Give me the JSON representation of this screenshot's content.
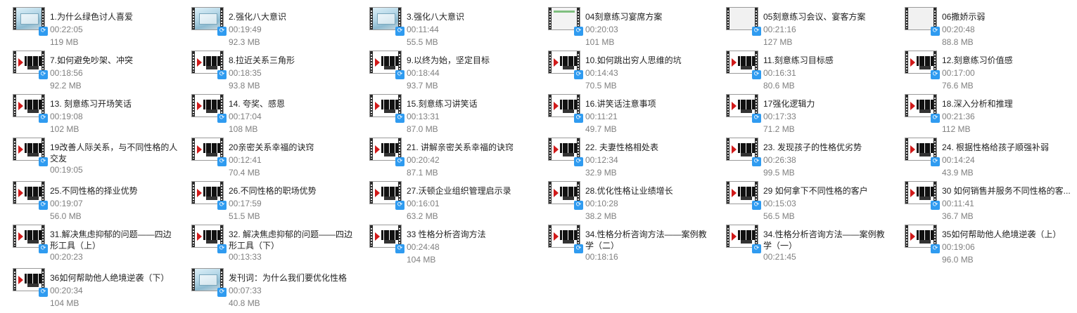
{
  "files": [
    {
      "name": "1.为什么绿色讨人喜爱",
      "duration": "00:22:05",
      "size": "119 MB",
      "thumb": "photo"
    },
    {
      "name": "2.强化八大意识",
      "duration": "00:19:49",
      "size": "92.3 MB",
      "thumb": "photo"
    },
    {
      "name": "3.强化八大意识",
      "duration": "00:11:44",
      "size": "55.5 MB",
      "thumb": "photo"
    },
    {
      "name": "04刻意练习宴席方案",
      "duration": "00:20:03",
      "size": "101 MB",
      "thumb": "doc"
    },
    {
      "name": "05刻意练习会议、宴客方案",
      "duration": "00:21:16",
      "size": "127 MB",
      "thumb": "blank"
    },
    {
      "name": "06撒娇示弱",
      "duration": "00:20:48",
      "size": "88.8 MB",
      "thumb": "blank"
    },
    {
      "name": "7.如何避免吵架、冲突",
      "duration": "00:18:56",
      "size": "92.2 MB",
      "thumb": "logo"
    },
    {
      "name": "8.拉近关系三角形",
      "duration": "00:18:35",
      "size": "93.8 MB",
      "thumb": "logo"
    },
    {
      "name": "9.以终为始，坚定目标",
      "duration": "00:18:44",
      "size": "93.7 MB",
      "thumb": "logo"
    },
    {
      "name": "10.如何跳出穷人思维的坑",
      "duration": "00:14:43",
      "size": "70.5 MB",
      "thumb": "logo"
    },
    {
      "name": "11.刻意练习目标感",
      "duration": "00:16:31",
      "size": "80.6 MB",
      "thumb": "logo"
    },
    {
      "name": "12.刻意练习价值感",
      "duration": "00:17:00",
      "size": "76.6 MB",
      "thumb": "logo"
    },
    {
      "name": "13. 刻意练习开场笑话",
      "duration": "00:19:08",
      "size": "102 MB",
      "thumb": "logo"
    },
    {
      "name": "14. 夸奖、感恩",
      "duration": "00:17:04",
      "size": "108 MB",
      "thumb": "logo"
    },
    {
      "name": "15.刻意练习讲笑话",
      "duration": "00:13:31",
      "size": "87.0 MB",
      "thumb": "logo"
    },
    {
      "name": "16.讲笑话注意事项",
      "duration": "00:11:21",
      "size": "49.7 MB",
      "thumb": "logo"
    },
    {
      "name": "17强化逻辑力",
      "duration": "00:17:33",
      "size": "71.2 MB",
      "thumb": "logo"
    },
    {
      "name": "18.深入分析和推理",
      "duration": "00:21:36",
      "size": "112 MB",
      "thumb": "logo"
    },
    {
      "name": "19改善人际关系，与不同性格的人交友",
      "duration": "00:19:05",
      "size": "",
      "thumb": "logo"
    },
    {
      "name": "20亲密关系幸福的诀窍",
      "duration": "00:12:41",
      "size": "70.4 MB",
      "thumb": "logo"
    },
    {
      "name": "21. 讲解亲密关系幸福的诀窍",
      "duration": "00:20:42",
      "size": "87.1 MB",
      "thumb": "logo"
    },
    {
      "name": "22. 夫妻性格相处表",
      "duration": "00:12:34",
      "size": "32.9 MB",
      "thumb": "logo"
    },
    {
      "name": "23. 发现孩子的性格优劣势",
      "duration": "00:26:38",
      "size": "99.5 MB",
      "thumb": "logo"
    },
    {
      "name": "24. 根据性格给孩子顺强补弱",
      "duration": "00:14:24",
      "size": "43.9 MB",
      "thumb": "logo"
    },
    {
      "name": "25.不同性格的择业优势",
      "duration": "00:19:07",
      "size": "56.0 MB",
      "thumb": "logo"
    },
    {
      "name": "26.不同性格的职场优势",
      "duration": "00:17:59",
      "size": "51.5 MB",
      "thumb": "logo"
    },
    {
      "name": "27.沃顿企业组织管理启示录",
      "duration": "00:16:01",
      "size": "63.2 MB",
      "thumb": "logo"
    },
    {
      "name": "28.优化性格让业绩增长",
      "duration": "00:10:28",
      "size": "38.2 MB",
      "thumb": "logo"
    },
    {
      "name": "29 如何拿下不同性格的客户",
      "duration": "00:15:03",
      "size": "56.5 MB",
      "thumb": "logo"
    },
    {
      "name": "30 如何销售并服务不同性格的客...",
      "duration": "00:11:41",
      "size": "36.7 MB",
      "thumb": "logo"
    },
    {
      "name": "31.解决焦虑抑郁的问题——四边形工具（上）",
      "duration": "00:20:23",
      "size": "",
      "thumb": "logo"
    },
    {
      "name": "32. 解决焦虑抑郁的问题——四边形工具（下）",
      "duration": "00:13:33",
      "size": "",
      "thumb": "logo"
    },
    {
      "name": "33 性格分析咨询方法",
      "duration": "00:24:48",
      "size": "104 MB",
      "thumb": "logo"
    },
    {
      "name": "34.性格分析咨询方法——案例教学（二）",
      "duration": "00:18:16",
      "size": "",
      "thumb": "logo"
    },
    {
      "name": "34.性格分析咨询方法——案例教学（一）",
      "duration": "00:21:45",
      "size": "",
      "thumb": "logo"
    },
    {
      "name": "35如何帮助他人绝境逆袭（上）",
      "duration": "00:19:06",
      "size": "96.0 MB",
      "thumb": "logo"
    },
    {
      "name": "36如何帮助他人绝境逆袭（下）",
      "duration": "00:20:34",
      "size": "104 MB",
      "thumb": "logo"
    },
    {
      "name": "发刊词：为什么我们要优化性格",
      "duration": "00:07:33",
      "size": "40.8 MB",
      "thumb": "photo"
    }
  ],
  "badge_icon": "cloud-sync-icon",
  "badge_glyph": "⟳",
  "colors": {
    "badge": "#2f9bf0",
    "meta": "#808080",
    "name": "#1f1f1f"
  }
}
